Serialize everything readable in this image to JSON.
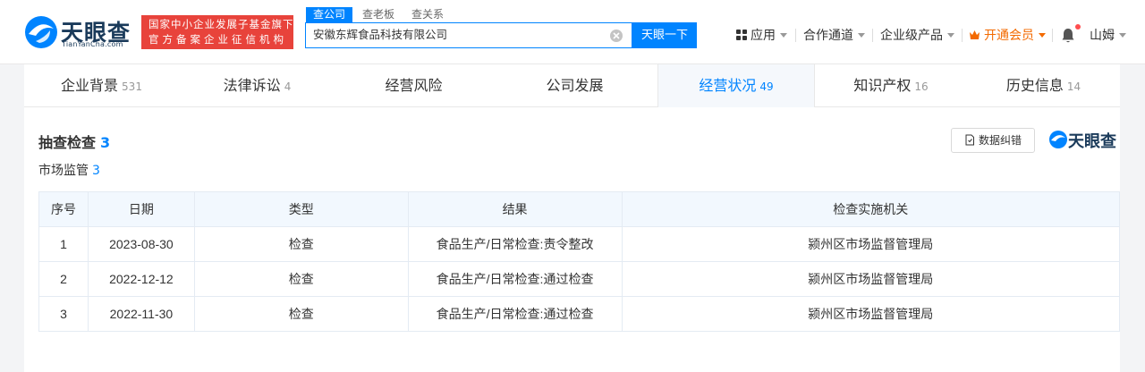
{
  "brand": {
    "logo_text": "天眼查",
    "logo_sub": "TianYanCha.com",
    "badge_line1": "国家中小企业发展子基金旗下",
    "badge_line2": "官方备案企业征信机构"
  },
  "search": {
    "tabs": [
      "查公司",
      "查老板",
      "查关系"
    ],
    "value": "安徽东辉食品科技有限公司",
    "button": "天眼一下"
  },
  "nav": {
    "apps": "应用",
    "cooperation": "合作通道",
    "enterprise": "企业级产品",
    "vip": "开通会员",
    "user": "山姆"
  },
  "tabs": [
    {
      "label": "企业背景",
      "count": "531"
    },
    {
      "label": "法律诉讼",
      "count": "4"
    },
    {
      "label": "经营风险",
      "count": ""
    },
    {
      "label": "公司发展",
      "count": ""
    },
    {
      "label": "经营状况",
      "count": "49"
    },
    {
      "label": "知识产权",
      "count": "16"
    },
    {
      "label": "历史信息",
      "count": "14"
    }
  ],
  "section": {
    "title": "抽查检查",
    "count": "3",
    "subtitle": "市场监管",
    "sub_count": "3",
    "error_button": "数据纠错",
    "watermark": "天眼查"
  },
  "table": {
    "headers": [
      "序号",
      "日期",
      "类型",
      "结果",
      "检查实施机关"
    ],
    "rows": [
      [
        "1",
        "2023-08-30",
        "检查",
        "食品生产/日常检查:责令整改",
        "颍州区市场监督管理局"
      ],
      [
        "2",
        "2022-12-12",
        "检查",
        "食品生产/日常检查:通过检查",
        "颍州区市场监督管理局"
      ],
      [
        "3",
        "2022-11-30",
        "检查",
        "食品生产/日常检查:通过检查",
        "颍州区市场监督管理局"
      ]
    ]
  },
  "colors": {
    "accent": "#0084ff",
    "badge": "#e8433b",
    "vip": "#f36a00"
  }
}
